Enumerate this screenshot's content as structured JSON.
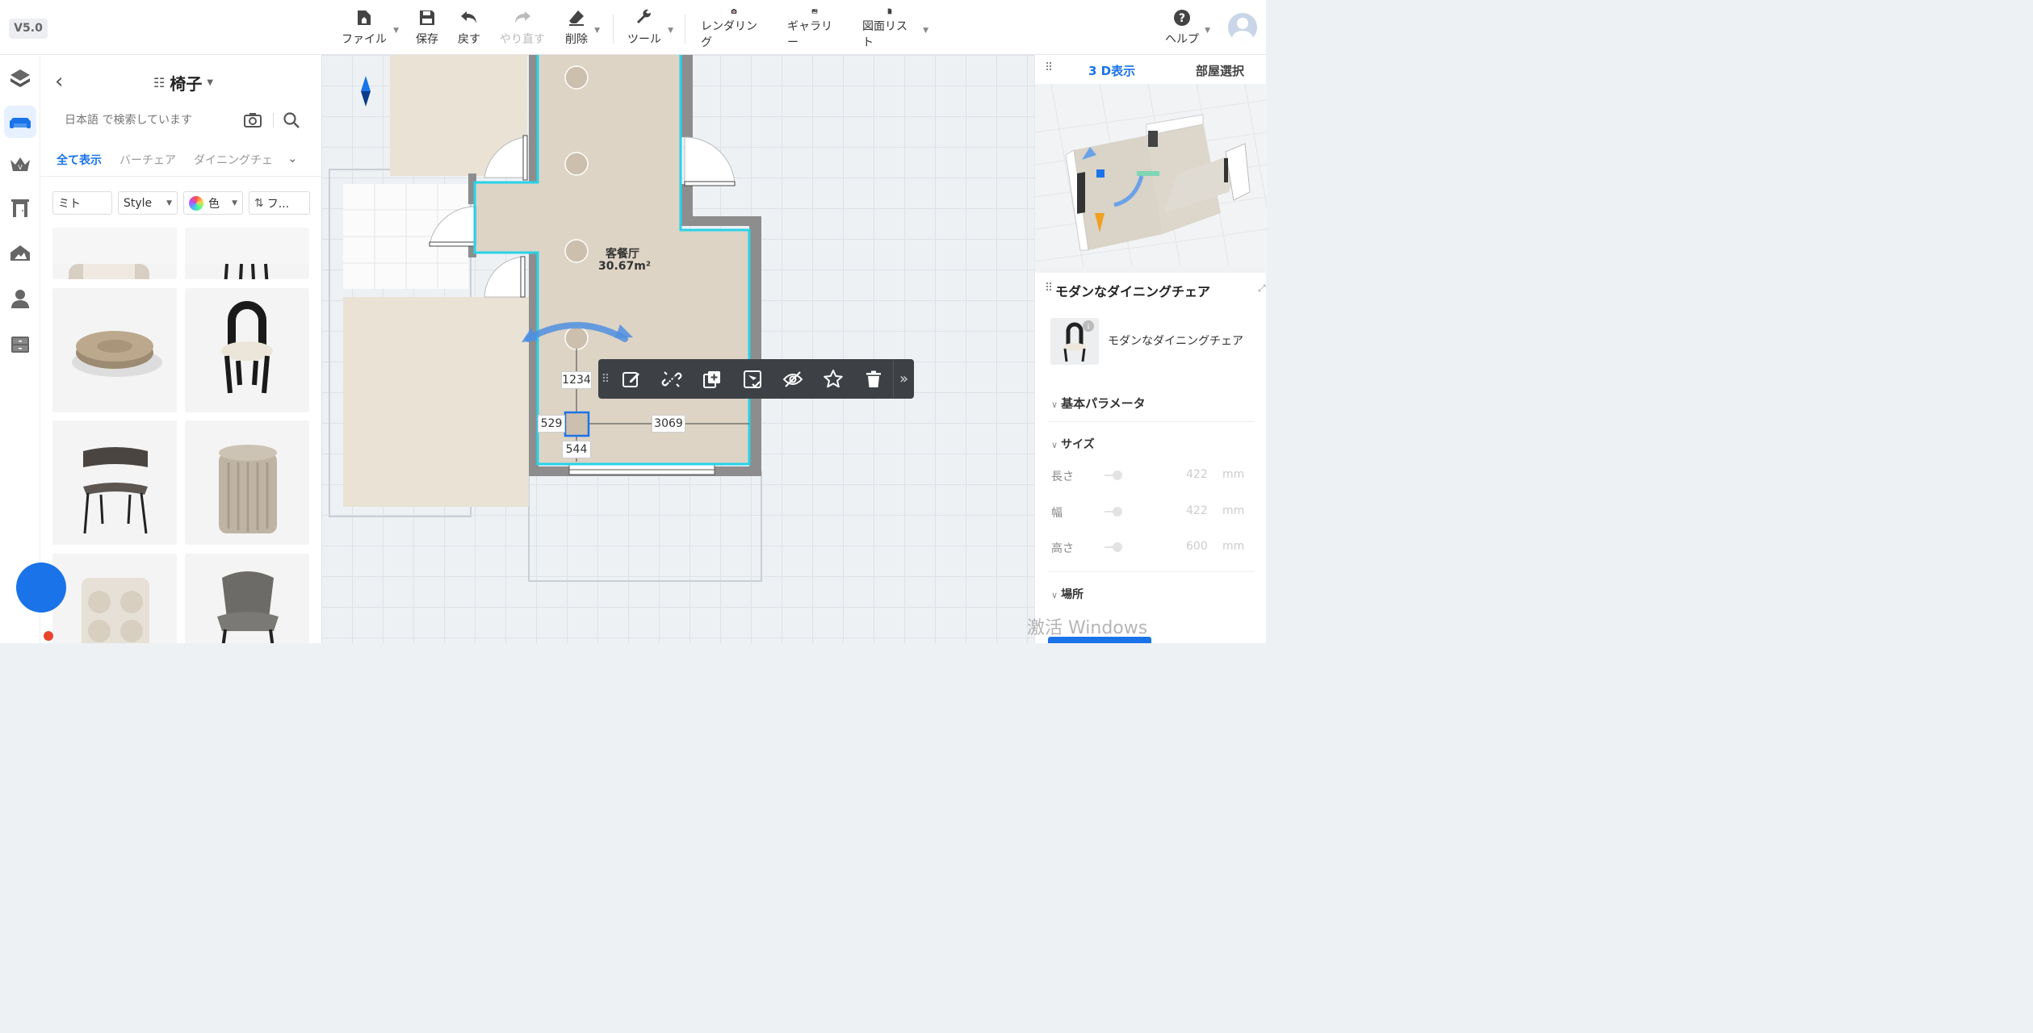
{
  "app": {
    "version": "V5.0"
  },
  "toolbar": {
    "file": "ファイル",
    "save": "保存",
    "undo": "戻す",
    "redo": "やり直す",
    "delete": "削除",
    "tools": "ツール",
    "rendering": "レンダリング",
    "gallery": "ギャラリー",
    "drawing_list": "図面リスト",
    "help": "ヘルプ"
  },
  "rail": {
    "items": [
      "floor-plan",
      "furniture",
      "premium",
      "door-window",
      "terrain",
      "person",
      "cabinet"
    ],
    "active": "furniture"
  },
  "catalog": {
    "title": "椅子",
    "search": {
      "placeholder": "日本語 で検索しています"
    },
    "tabs": [
      "全て表示",
      "バーチェア",
      "ダイニングチェ"
    ],
    "active_tab": "全て表示",
    "filters": {
      "first": "ミト",
      "style": "Style",
      "color": "色",
      "sort": "フ..."
    },
    "items": [
      {
        "name": "upholstered-stool"
      },
      {
        "name": "black-chair"
      },
      {
        "name": "rattan-pouf"
      },
      {
        "name": "arched-back-stool"
      },
      {
        "name": "modern-dining-chair"
      },
      {
        "name": "ribbed-ottoman"
      },
      {
        "name": "bubble-cube-chair"
      },
      {
        "name": "grey-armchair"
      }
    ]
  },
  "canvas": {
    "room": {
      "name": "客餐厅",
      "area": "30.67m²"
    },
    "dimensions": {
      "top": "1234",
      "left": "529",
      "right": "3069",
      "bottom": "544"
    },
    "object_toolbar": [
      "edit",
      "unlink",
      "duplicate",
      "replace",
      "hide",
      "favorite",
      "delete"
    ]
  },
  "right_panel": {
    "tabs": {
      "view3d": "3 D表示",
      "room_select": "部屋選択"
    },
    "object": {
      "title": "モダンなダイニングチェア",
      "name": "モダンなダイニングチェア"
    },
    "sections": {
      "basic": "基本パラメータ",
      "size": "サイズ",
      "location": "場所"
    },
    "params": [
      {
        "label": "長さ",
        "value": "422",
        "unit": "mm"
      },
      {
        "label": "幅",
        "value": "422",
        "unit": "mm"
      },
      {
        "label": "高さ",
        "value": "600",
        "unit": "mm"
      }
    ]
  },
  "colors": {
    "accent": "#1a73e8",
    "selection": "#27d3e8",
    "toolbar_dark": "#3d4146"
  },
  "watermark": "激活 Windows"
}
